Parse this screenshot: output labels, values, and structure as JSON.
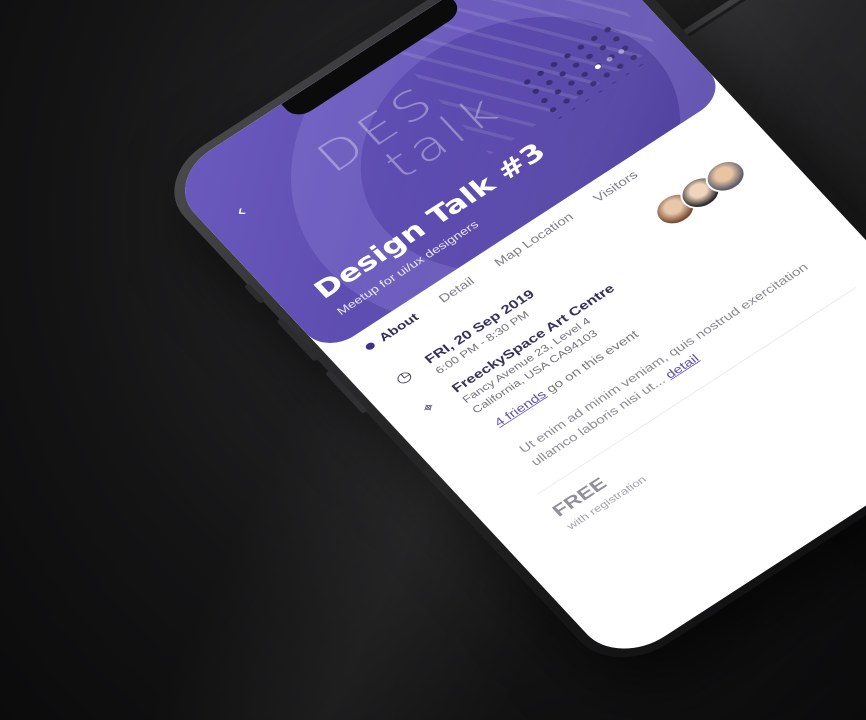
{
  "app": {
    "hero": {
      "watermark_line1": "DES",
      "watermark_line2": "talk",
      "title": "Design Talk #3",
      "subtitle": "Meetup for ui/ux designers",
      "back_icon": "chevron-left-icon",
      "top_icons": [
        "heart-icon",
        "share-icon"
      ],
      "pager": {
        "count": 3,
        "active_index": 0
      }
    },
    "tabs": [
      {
        "label": "About",
        "active": true
      },
      {
        "label": "Detail",
        "active": false
      },
      {
        "label": "Map Location",
        "active": false
      },
      {
        "label": "Visitors",
        "active": false
      }
    ],
    "event": {
      "date": "FRI, 20 Sep 2019",
      "time": "6:00 PM - 8:30 PM",
      "venue": "FreeckySpace Art Centre",
      "address_line1": "Fancy Avenue 23, Level 4",
      "address_line2": "California, USA CA94103"
    },
    "friends": {
      "link_text": "4 friends",
      "rest_text": " go on this event"
    },
    "description": {
      "text": "Ut enim ad minim veniam, quis nostrud exercitation ullamco laboris nisi ut... ",
      "link": "detail"
    },
    "price": {
      "label": "FREE",
      "sub": "with registration"
    },
    "colors": {
      "accent": "#5a4db2",
      "hero": "#5847ab",
      "title_text": "#2b2856"
    }
  }
}
